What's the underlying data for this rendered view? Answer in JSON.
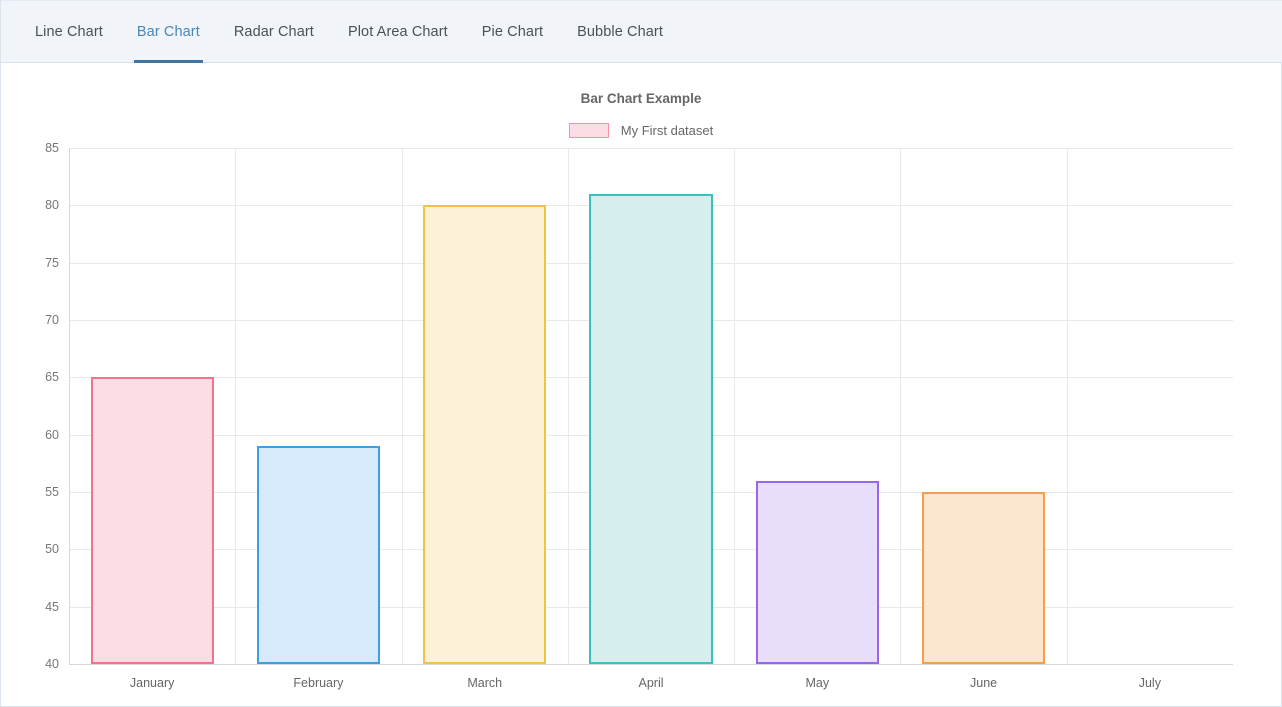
{
  "tabs": [
    {
      "label": "Line Chart",
      "active": false
    },
    {
      "label": "Bar Chart",
      "active": true
    },
    {
      "label": "Radar Chart",
      "active": false
    },
    {
      "label": "Plot Area Chart",
      "active": false
    },
    {
      "label": "Pie Chart",
      "active": false
    },
    {
      "label": "Bubble Chart",
      "active": false
    }
  ],
  "chart_data": {
    "type": "bar",
    "title": "Bar Chart Example",
    "xlabel": "",
    "ylabel": "",
    "categories": [
      "January",
      "February",
      "March",
      "April",
      "May",
      "June",
      "July"
    ],
    "series": [
      {
        "name": "My First dataset",
        "values": [
          65,
          59,
          80,
          81,
          56,
          55,
          null
        ]
      }
    ],
    "ylim": [
      40,
      85
    ],
    "ytick_step": 5,
    "yticks": [
      40,
      45,
      50,
      55,
      60,
      65,
      70,
      75,
      80,
      85
    ],
    "grid": true,
    "legend_position": "top",
    "bar_colors": [
      {
        "fill": "#fcdce5",
        "border": "#f4718f"
      },
      {
        "fill": "#d6eafb",
        "border": "#3d9ee5"
      },
      {
        "fill": "#fdf1d8",
        "border": "#f3c33f"
      },
      {
        "fill": "#d5eeee",
        "border": "#3bbfbf"
      },
      {
        "fill": "#e8ddfa",
        "border": "#9666ec"
      },
      {
        "fill": "#fde6d0",
        "border": "#f59f4a"
      },
      {
        "fill": "#fcdce5",
        "border": "#f4718f"
      }
    ],
    "legend_swatch_color": {
      "fill": "#fcdce5",
      "border": "#f78fa7"
    }
  }
}
